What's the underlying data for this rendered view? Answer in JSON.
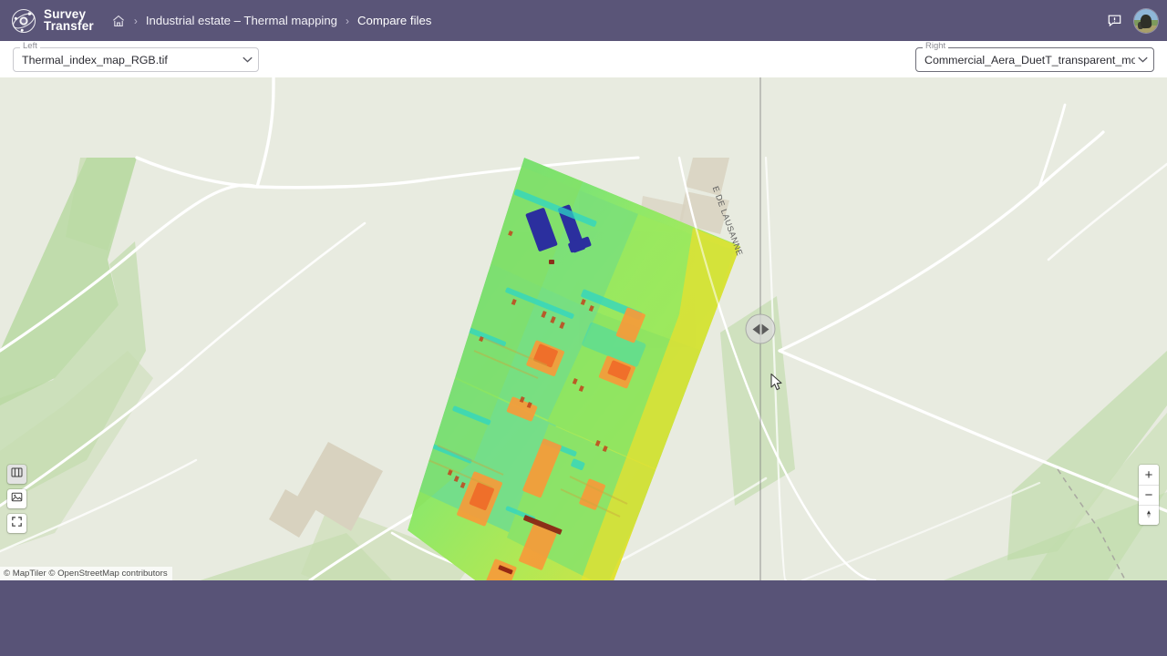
{
  "app": {
    "brand_line1": "Survey",
    "brand_line2": "Transfer",
    "logo_icon": "orbit-atom-icon",
    "header_color": "#5a5578"
  },
  "breadcrumb": {
    "home_icon": "home-icon",
    "separator": "›",
    "items": [
      {
        "label": "Industrial estate – Thermal mapping"
      },
      {
        "label": "Compare files"
      }
    ]
  },
  "header_actions": {
    "feedback_icon": "feedback-message-icon",
    "avatar_icon": "user-avatar"
  },
  "selectors": {
    "left": {
      "label": "Left",
      "value": "Thermal_index_map_RGB.tif",
      "caret_icon": "chevron-down-icon"
    },
    "right": {
      "label": "Right",
      "value": "Commercial_Aera_DuetT_transparent_mosaic_RGB....",
      "caret_icon": "chevron-down-icon"
    }
  },
  "map": {
    "tools": [
      {
        "name": "basemap-toggle",
        "icon": "map-book-icon",
        "active": true
      },
      {
        "name": "layers-toggle",
        "icon": "image-layer-icon",
        "active": false
      },
      {
        "name": "fullscreen-toggle",
        "icon": "fullscreen-icon",
        "active": false
      }
    ],
    "zoom_controls": {
      "zoom_in_label": "+",
      "zoom_out_label": "−",
      "compass_icon": "compass-north-icon"
    },
    "road_label": "E DE LAUSANNE",
    "attribution": "© MapTiler © OpenStreetMap contributors",
    "compare_handle_icon": "compare-slider-handle",
    "colors": {
      "land": "#e8ebe0",
      "green": "#b9d9a2",
      "green_light": "#cfe0bc",
      "road": "#ffffff",
      "building": "#d8d2bf"
    }
  },
  "cursor": {
    "icon": "mouse-pointer-icon"
  }
}
